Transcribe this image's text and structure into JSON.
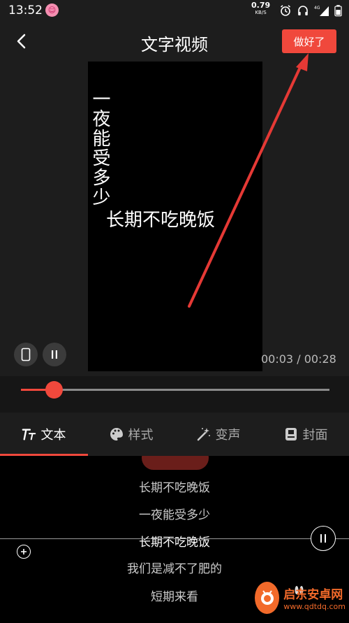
{
  "status_bar": {
    "time": "13:52",
    "speed_value": "0.79",
    "speed_unit": "KB/S",
    "network": "4G"
  },
  "header": {
    "title": "文字视频",
    "done_label": "做好了"
  },
  "preview": {
    "vertical_text": "一夜能受多少",
    "main_text": "长期不吃晚饭",
    "time_current": "00:03",
    "time_separator": "/",
    "time_total": "00:28",
    "progress": 0.107
  },
  "tabs": [
    {
      "label": "文本",
      "icon": "text-format-icon",
      "active": true
    },
    {
      "label": "样式",
      "icon": "palette-icon",
      "active": false
    },
    {
      "label": "变声",
      "icon": "magic-wand-icon",
      "active": false
    },
    {
      "label": "封面",
      "icon": "cover-icon",
      "active": false
    }
  ],
  "lyrics": {
    "lines": [
      "长期不吃晚饭",
      "一夜能受多少",
      "长期不吃晚饭",
      "我们是减不了肥的",
      "短期来看"
    ],
    "current_index": 2
  },
  "watermark": {
    "name": "启东安卓网",
    "url": "www.qdtdq.com"
  },
  "colors": {
    "accent": "#f0483c",
    "background": "#1d1d1d"
  }
}
